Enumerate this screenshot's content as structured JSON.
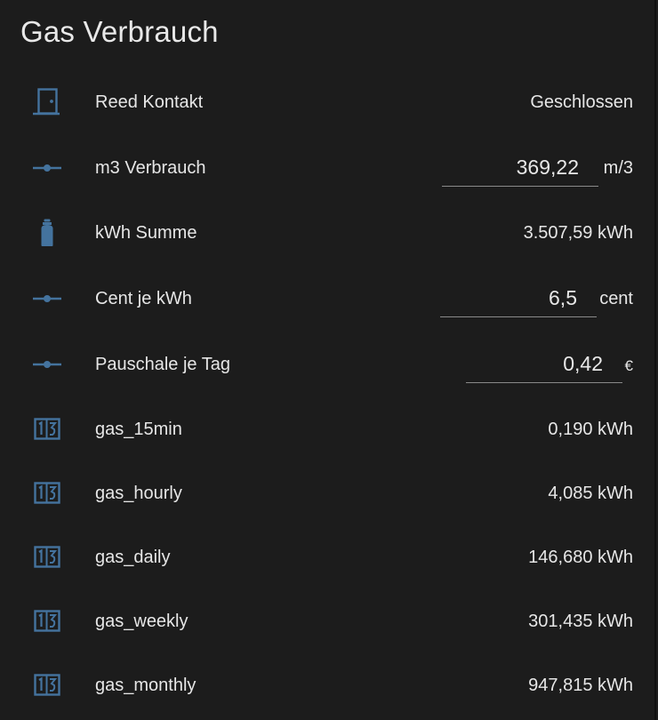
{
  "card": {
    "title": "Gas Verbrauch"
  },
  "colors": {
    "background": "#1c1c1c",
    "icon": "#44739e",
    "text": "#e1e1e1",
    "underline": "#8a8a8a"
  },
  "rows": [
    {
      "label": "Reed Kontakt",
      "state": "Geschlossen",
      "icon": "door-icon",
      "type": "state"
    },
    {
      "label": "m3 Verbrauch",
      "value": "369,22",
      "unit": "m/3",
      "icon": "ray-vertex-icon",
      "type": "input"
    },
    {
      "label": "kWh Summe",
      "state": "3.507,59 kWh",
      "icon": "gas-cylinder-icon",
      "type": "state"
    },
    {
      "label": "Cent je kWh",
      "value": "6,5",
      "unit": "cent",
      "icon": "ray-vertex-icon",
      "type": "input"
    },
    {
      "label": "Pauschale je Tag",
      "value": "0,42",
      "unit": "€",
      "icon": "ray-vertex-icon",
      "type": "input"
    },
    {
      "label": "gas_15min",
      "state": "0,190 kWh",
      "icon": "counter-icon",
      "type": "state"
    },
    {
      "label": "gas_hourly",
      "state": "4,085 kWh",
      "icon": "counter-icon",
      "type": "state"
    },
    {
      "label": "gas_daily",
      "state": "146,680 kWh",
      "icon": "counter-icon",
      "type": "state"
    },
    {
      "label": "gas_weekly",
      "state": "301,435 kWh",
      "icon": "counter-icon",
      "type": "state"
    },
    {
      "label": "gas_monthly",
      "state": "947,815 kWh",
      "icon": "counter-icon",
      "type": "state"
    }
  ]
}
